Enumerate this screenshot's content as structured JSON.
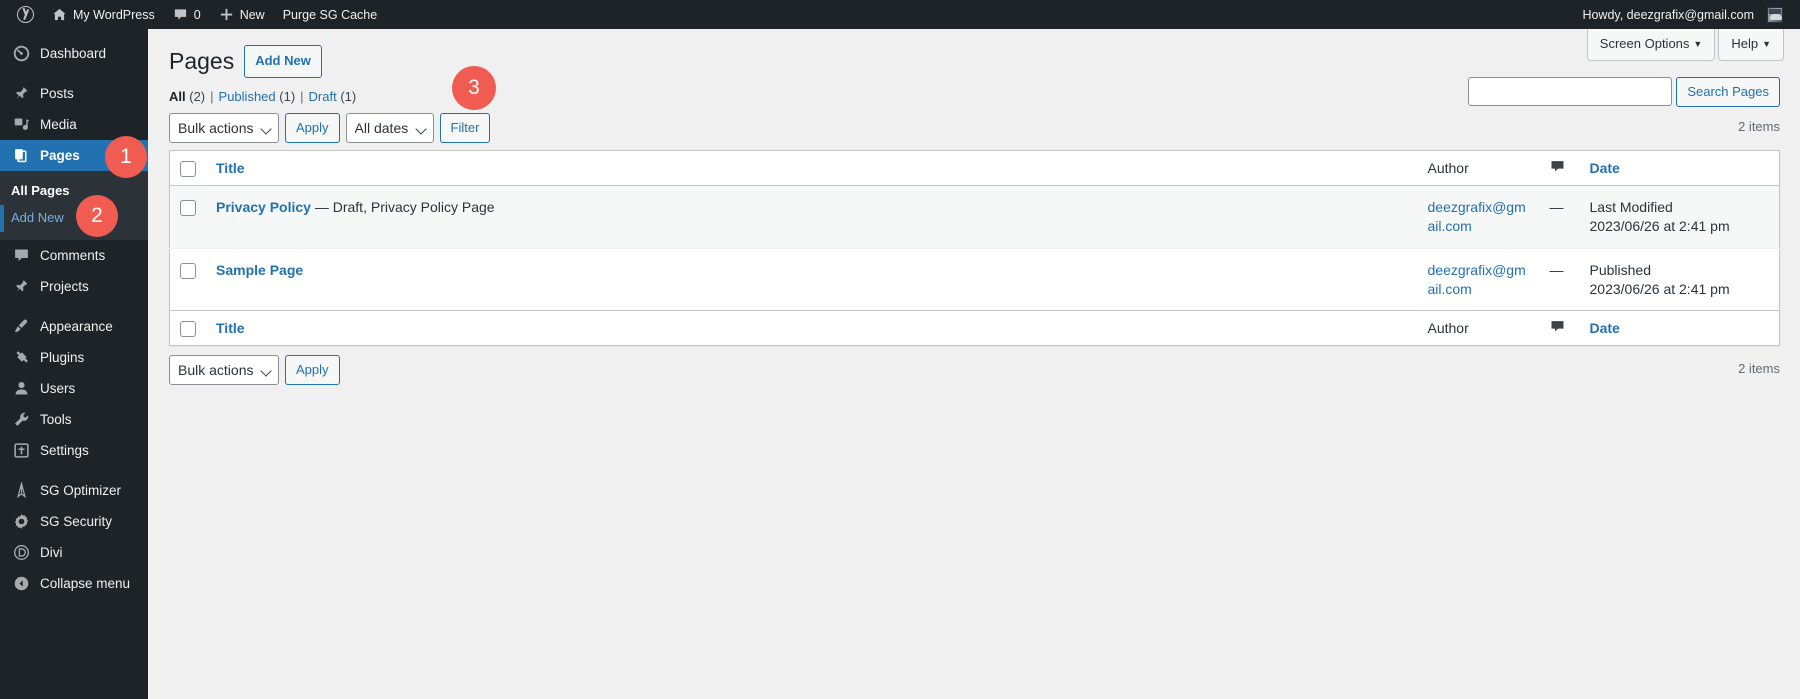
{
  "adminbar": {
    "wp_logo": "wordpress-logo",
    "site_name": "My WordPress",
    "comment_count": "0",
    "new_label": "New",
    "purge_label": "Purge SG Cache",
    "howdy": "Howdy, deezgrafix@gmail.com"
  },
  "sidebar": {
    "items": [
      {
        "label": "Dashboard",
        "icon": "dashboard-icon",
        "current": false
      },
      {
        "label": "Posts",
        "icon": "pin-icon",
        "current": false
      },
      {
        "label": "Media",
        "icon": "media-icon",
        "current": false
      },
      {
        "label": "Pages",
        "icon": "pages-icon",
        "current": true
      },
      {
        "label": "Comments",
        "icon": "comment-icon",
        "current": false
      },
      {
        "label": "Projects",
        "icon": "pin-icon",
        "current": false
      },
      {
        "label": "Appearance",
        "icon": "brush-icon",
        "current": false
      },
      {
        "label": "Plugins",
        "icon": "plug-icon",
        "current": false
      },
      {
        "label": "Users",
        "icon": "user-icon",
        "current": false
      },
      {
        "label": "Tools",
        "icon": "wrench-icon",
        "current": false
      },
      {
        "label": "Settings",
        "icon": "settings-icon",
        "current": false
      },
      {
        "label": "SG Optimizer",
        "icon": "sg-optimizer-icon",
        "current": false
      },
      {
        "label": "SG Security",
        "icon": "sg-security-icon",
        "current": false
      },
      {
        "label": "Divi",
        "icon": "divi-icon",
        "current": false
      },
      {
        "label": "Collapse menu",
        "icon": "collapse-icon",
        "current": false
      }
    ],
    "submenu": [
      {
        "label": "All Pages",
        "state": "current"
      },
      {
        "label": "Add New",
        "state": "hover"
      }
    ]
  },
  "screen_meta": {
    "screen_options": "Screen Options",
    "help": "Help",
    "caret": "▼"
  },
  "header": {
    "title": "Pages",
    "add_new": "Add New"
  },
  "status_filters": [
    {
      "label": "All",
      "count": "(2)",
      "current": true
    },
    {
      "label": "Published",
      "count": "(1)",
      "current": false
    },
    {
      "label": "Draft",
      "count": "(1)",
      "current": false
    }
  ],
  "search": {
    "value": "",
    "placeholder": "",
    "button": "Search Pages"
  },
  "tablenav_top": {
    "bulk_actions": "Bulk actions",
    "apply": "Apply",
    "all_dates": "All dates",
    "filter": "Filter",
    "displaying_num": "2 items"
  },
  "tablenav_bottom": {
    "bulk_actions": "Bulk actions",
    "apply": "Apply",
    "displaying_num": "2 items"
  },
  "table": {
    "columns": {
      "title": "Title",
      "author": "Author",
      "comments": "comment-bubble-icon",
      "date": "Date"
    },
    "rows": [
      {
        "title": "Privacy Policy",
        "post_state": "— Draft, Privacy Policy Page",
        "author": "deezgrafix@gmail.com",
        "comments": "—",
        "date_label": "Last Modified",
        "date_value": "2023/06/26 at 2:41 pm"
      },
      {
        "title": "Sample Page",
        "post_state": "",
        "author": "deezgrafix@gmail.com",
        "comments": "—",
        "date_label": "Published",
        "date_value": "2023/06/26 at 2:41 pm"
      }
    ]
  },
  "annotations": [
    {
      "number": "1",
      "target": "sidebar-item-pages"
    },
    {
      "number": "2",
      "target": "submenu-add-new"
    },
    {
      "number": "3",
      "target": "add-new-button"
    }
  ],
  "colors": {
    "admin_dark": "#1d2327",
    "admin_accent": "#2271b1",
    "annotation_red": "#f05b52",
    "page_bg": "#f0f0f1"
  }
}
